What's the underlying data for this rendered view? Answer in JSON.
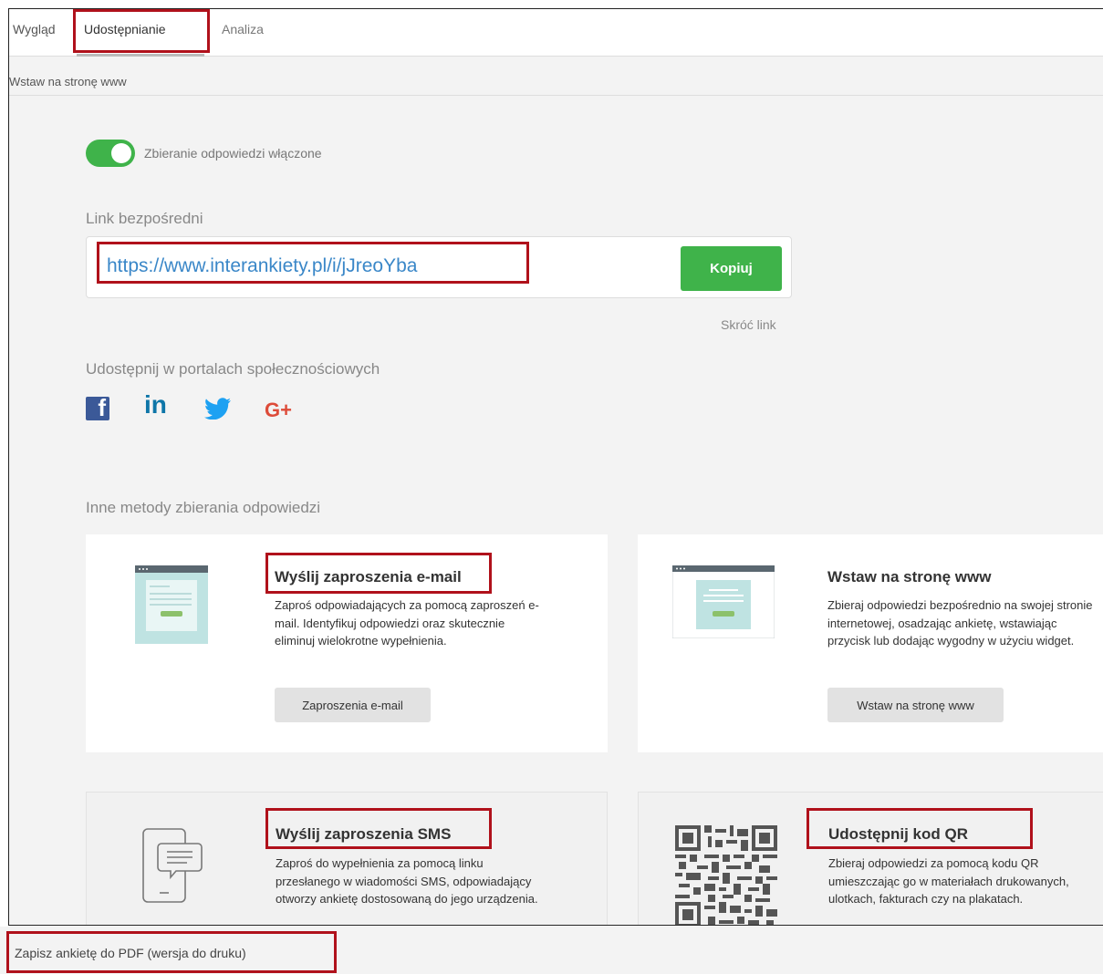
{
  "tabs": [
    {
      "label": "Wygląd"
    },
    {
      "label": "Udostępnianie"
    },
    {
      "label": "Analiza"
    }
  ],
  "subnav": {
    "label": "Wstaw na stronę www"
  },
  "toggle": {
    "label": "Zbieranie odpowiedzi włączone",
    "on": true
  },
  "link": {
    "section_label": "Link bezpośredni",
    "url": "https://www.interankiety.pl/i/jJreoYba",
    "copy_label": "Kopiuj",
    "shorten_label": "Skróć link"
  },
  "social": {
    "section_label": "Udostępnij w portalach społecznościowych",
    "items": [
      {
        "icon": "facebook-icon",
        "glyph": "f"
      },
      {
        "icon": "linkedin-icon",
        "glyph": "in"
      },
      {
        "icon": "twitter-icon"
      },
      {
        "icon": "google-plus-icon",
        "glyph": "G+"
      }
    ]
  },
  "other_methods": {
    "section_label": "Inne metody zbierania odpowiedzi",
    "cards": [
      {
        "title": "Wyślij zaproszenia e-mail",
        "desc": "Zaproś odpowiadających za pomocą zaproszeń e-mail. Identyfikuj odpowiedzi oraz skutecznie eliminuj wielokrotne wypełnienia.",
        "button": "Zaproszenia e-mail"
      },
      {
        "title": "Wstaw na stronę www",
        "desc": "Zbieraj odpowiedzi bezpośrednio na swojej stronie internetowej, osadzając ankietę, wstawiając przycisk lub dodając wygodny w użyciu widget.",
        "button": "Wstaw na stronę www"
      },
      {
        "title": "Wyślij zaproszenia SMS",
        "desc": "Zaproś do wypełnienia za pomocą linku przesłanego w wiadomości SMS, odpowiadający otworzy ankietę dostosowaną do jego urządzenia."
      },
      {
        "title": "Udostępnij kod QR",
        "desc": "Zbieraj odpowiedzi za pomocą kodu QR umieszczając go w materiałach drukowanych, ulotkach, fakturach czy na plakatach."
      }
    ]
  },
  "bottom": {
    "label": "Zapisz ankietę do PDF (wersja do druku)"
  },
  "colors": {
    "accent_green": "#3fb34a",
    "link_blue": "#3a87c8",
    "highlight_red": "#b0111b"
  }
}
